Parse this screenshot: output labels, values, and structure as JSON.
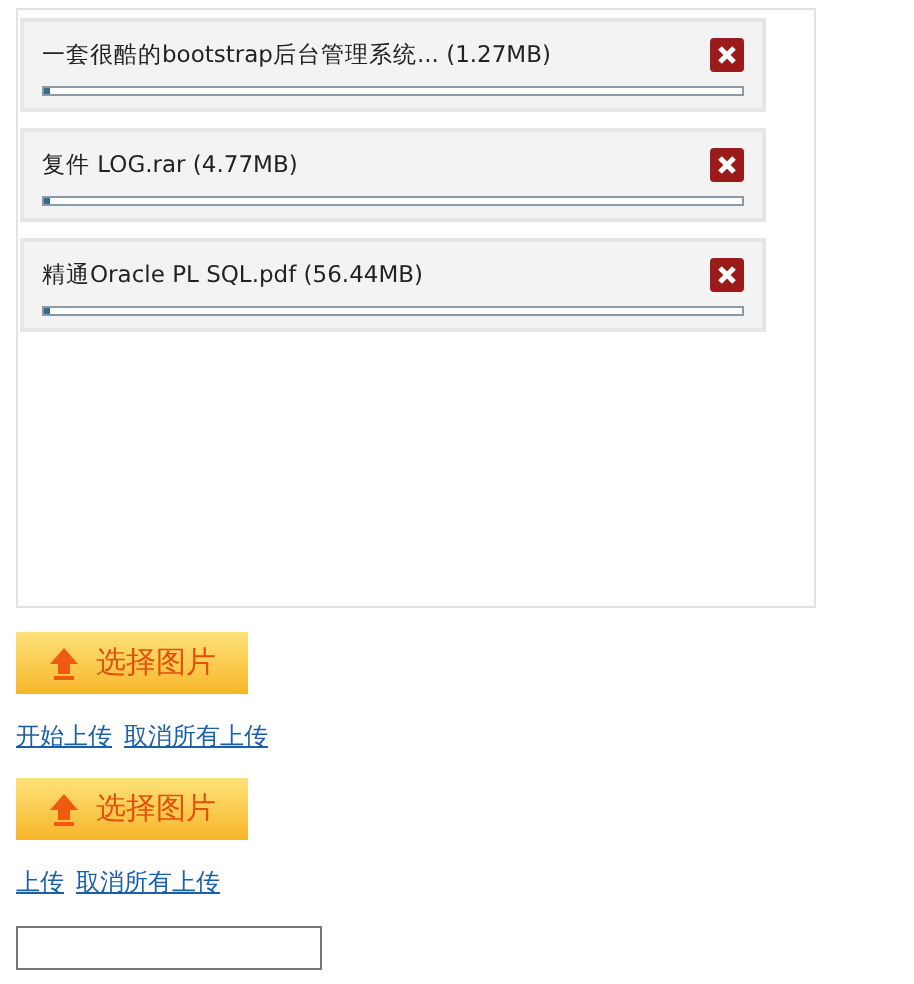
{
  "queue": [
    {
      "name": "一套很酷的bootstrap后台管理系统... (1.27MB)",
      "level": 0.01
    },
    {
      "name": "复件 LOG.rar (4.77MB)",
      "level": 0.01
    },
    {
      "name": "精通Oracle PL SQL.pdf (56.44MB)",
      "level": 0.01
    }
  ],
  "sections": [
    {
      "button": "选择图片",
      "links": [
        "开始上传",
        "取消所有上传"
      ]
    },
    {
      "button": "选择图片",
      "links": [
        "上传",
        "取消所有上传"
      ]
    }
  ]
}
